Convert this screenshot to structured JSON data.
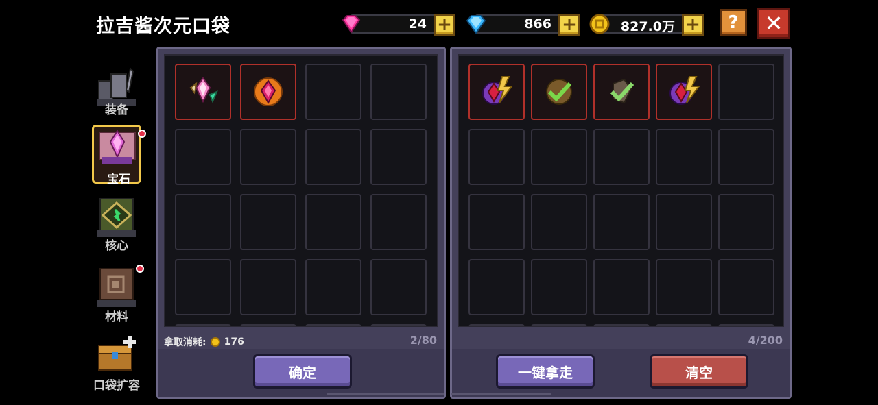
{
  "title": "拉吉酱次元口袋",
  "currency": {
    "pink_gem": "24",
    "diamond": "866",
    "gold": "827.0万",
    "plus_label": "+"
  },
  "header": {
    "help_label": "?",
    "close_label": "✕"
  },
  "nav": {
    "items": [
      {
        "label": "装备",
        "icon": "equipment-icon",
        "badge": false
      },
      {
        "label": "宝石",
        "icon": "gem-icon",
        "badge": true,
        "active": true
      },
      {
        "label": "核心",
        "icon": "core-icon",
        "badge": false
      },
      {
        "label": "材料",
        "icon": "material-icon",
        "badge": true
      },
      {
        "label": "口袋扩容",
        "icon": "chest-icon",
        "badge": false
      }
    ]
  },
  "left_panel": {
    "cost_label": "拿取消耗:",
    "cost_value": "176",
    "count": "2/80",
    "confirm_label": "确定",
    "items": [
      "pink-wing-gem-icon",
      "orange-flame-gem-icon"
    ]
  },
  "right_panel": {
    "count": "4/200",
    "take_all_label": "一键拿走",
    "clear_label": "清空",
    "items": [
      "purple-lightning-gem-icon",
      "green-check-gem-icon",
      "green-check-gem-icon-2",
      "purple-lightning-gem-icon-2"
    ]
  },
  "colors": {
    "accent_gold": "#f2c84a",
    "panel_bg": "#44405a",
    "button_purple": "#7868b8",
    "button_red": "#b8504a",
    "item_border": "#b0302a"
  }
}
